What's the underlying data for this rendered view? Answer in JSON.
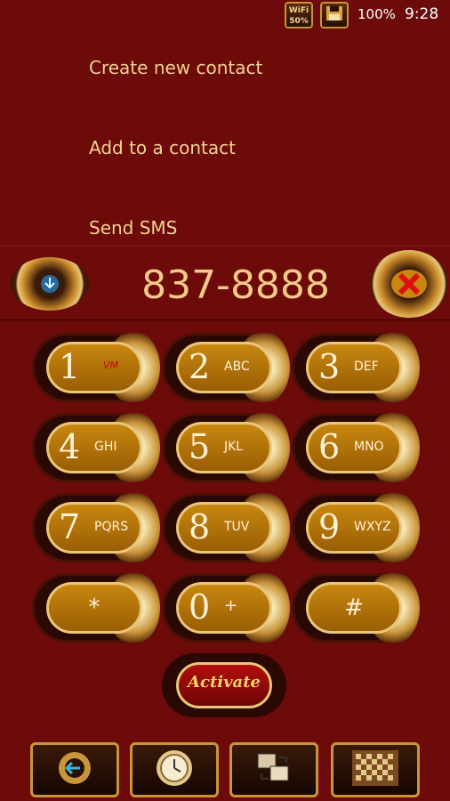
{
  "status_bar": {
    "wifi_badge": "WiFi\n50%",
    "battery_text": "100%",
    "time": "9:28"
  },
  "menu": {
    "items": [
      {
        "label": "Create new contact"
      },
      {
        "label": "Add to a contact"
      },
      {
        "label": "Send SMS"
      }
    ]
  },
  "dialer": {
    "number": "837-8888",
    "left_icon": "download-gear-icon",
    "right_icon": "delete-x-icon"
  },
  "keypad": {
    "keys": [
      {
        "digit": "1",
        "letters": "VM"
      },
      {
        "digit": "2",
        "letters": "ABC"
      },
      {
        "digit": "3",
        "letters": "DEF"
      },
      {
        "digit": "4",
        "letters": "GHI"
      },
      {
        "digit": "5",
        "letters": "JKL"
      },
      {
        "digit": "6",
        "letters": "MNO"
      },
      {
        "digit": "7",
        "letters": "PQRS"
      },
      {
        "digit": "8",
        "letters": "TUV"
      },
      {
        "digit": "9",
        "letters": "WXYZ"
      },
      {
        "digit": "*",
        "letters": ""
      },
      {
        "digit": "0",
        "letters": "+"
      },
      {
        "digit": "#",
        "letters": ""
      }
    ],
    "activate_label": "Activate"
  },
  "nav": {
    "buttons": [
      {
        "icon": "back-gear-icon"
      },
      {
        "icon": "clock-icon"
      },
      {
        "icon": "switch-app-icon"
      },
      {
        "icon": "checkerboard-icon"
      }
    ]
  },
  "colors": {
    "background": "#6d0a0a",
    "text_gold": "#f0d28f",
    "key_gold": "#c8870f"
  }
}
